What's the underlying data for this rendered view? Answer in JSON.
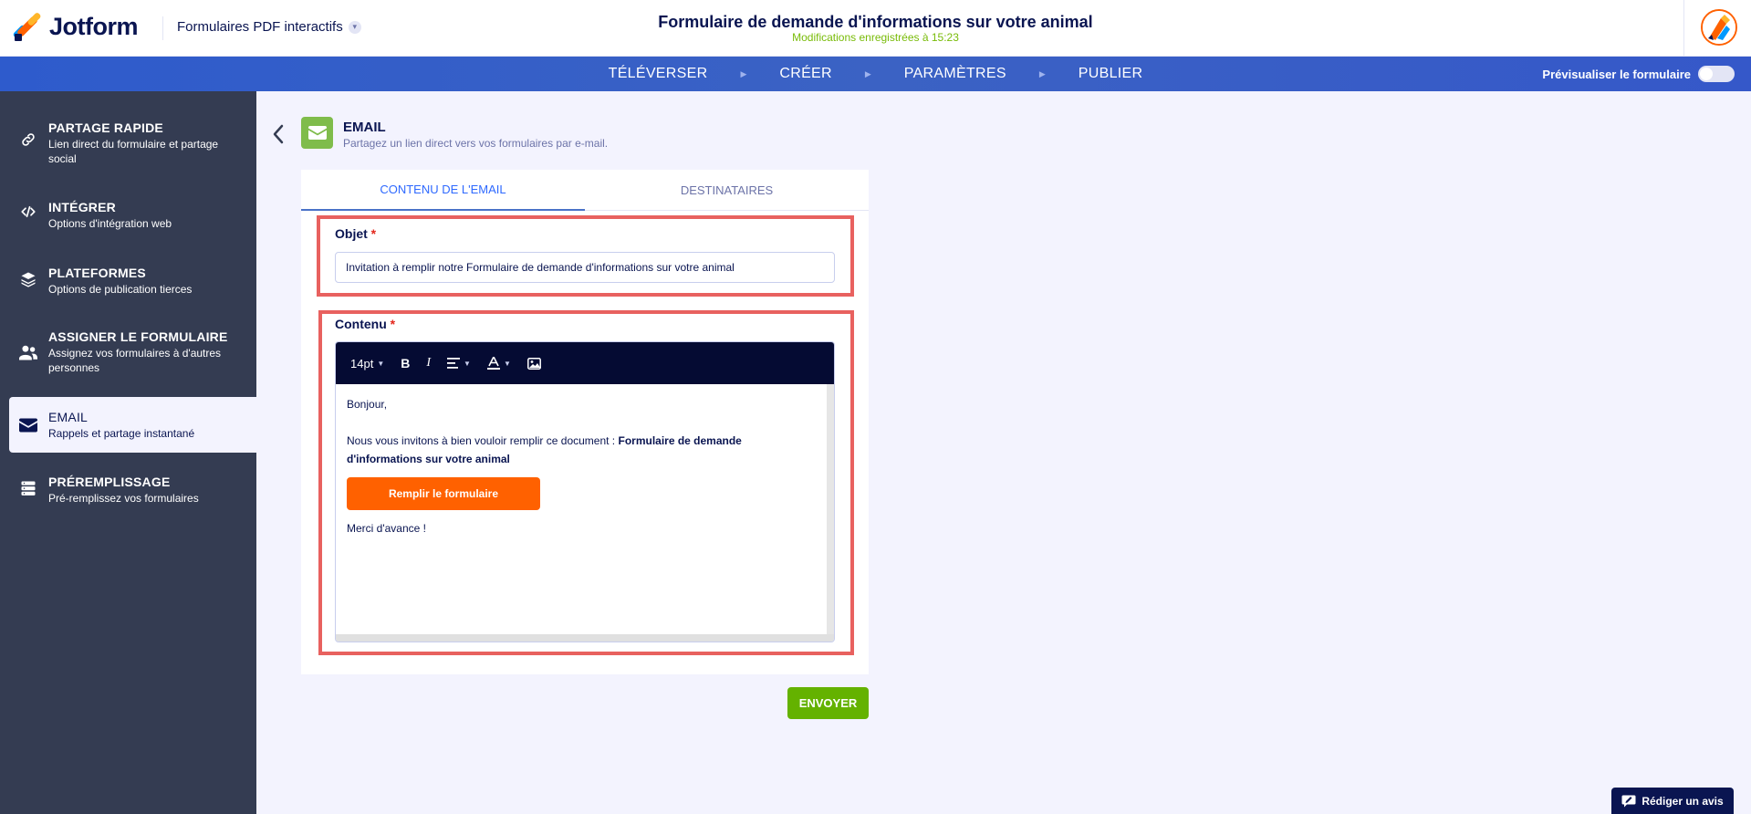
{
  "header": {
    "logo_text": "Jotform",
    "product_label": "Formulaires PDF interactifs",
    "form_title": "Formulaire de demande d'informations sur votre animal",
    "save_status": "Modifications enregistrées à 15:23"
  },
  "nav": {
    "items": [
      {
        "label": "TÉLÉVERSER"
      },
      {
        "label": "CRÉER"
      },
      {
        "label": "PARAMÈTRES"
      },
      {
        "label": "PUBLIER"
      }
    ],
    "preview_label": "Prévisualiser le formulaire",
    "preview_on": false
  },
  "sidebar": {
    "items": [
      {
        "title": "PARTAGE RAPIDE",
        "desc": "Lien direct du formulaire et partage social",
        "icon": "link-icon"
      },
      {
        "title": "INTÉGRER",
        "desc": "Options d'intégration web",
        "icon": "code-icon"
      },
      {
        "title": "PLATEFORMES",
        "desc": "Options de publication tierces",
        "icon": "layers-icon"
      },
      {
        "title": "ASSIGNER LE FORMULAIRE",
        "desc": "Assignez vos formulaires à d'autres personnes",
        "icon": "users-icon"
      },
      {
        "title": "EMAIL",
        "desc": "Rappels et partage instantané",
        "icon": "envelope-icon",
        "active": true
      },
      {
        "title": "PRÉREMPLISSAGE",
        "desc": "Pré-remplissez vos formulaires",
        "icon": "database-icon"
      }
    ]
  },
  "email": {
    "title": "EMAIL",
    "subtitle": "Partagez un lien direct vers vos formulaires par e-mail.",
    "tabs": [
      {
        "label": "CONTENU DE L'EMAIL",
        "active": true
      },
      {
        "label": "DESTINATAIRES",
        "active": false
      }
    ],
    "subject_label": "Objet",
    "subject_value": "Invitation à remplir notre Formulaire de demande d'informations sur votre animal",
    "content_label": "Contenu",
    "required_mark": "*",
    "toolbar": {
      "font_size": "14pt",
      "bold": "B",
      "italic": "I"
    },
    "body": {
      "greeting": "Bonjour,",
      "intro": "Nous vous invitons à bien vouloir remplir ce document : ",
      "form_name": "Formulaire de demande d'informations sur votre animal",
      "cta_label": "Remplir le formulaire",
      "closing": "Merci d'avance !"
    },
    "send_label": "ENVOYER"
  },
  "review_label": "Rédiger un avis",
  "colors": {
    "sidebar_bg": "#343c52",
    "nav_bg": "#3b62c4",
    "highlight_border": "#e8615f",
    "cta_orange": "#ff6100",
    "send_green": "#64b200",
    "save_status_green": "#78bb07"
  }
}
